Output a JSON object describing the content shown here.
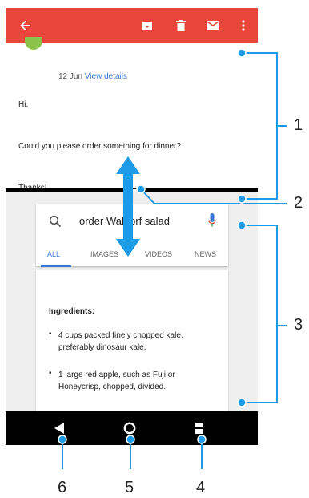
{
  "toolbar": {
    "back_icon": "arrow-back-icon",
    "archive_icon": "archive-icon",
    "delete_icon": "trash-icon",
    "mail_icon": "mail-icon",
    "more_icon": "more-vert-icon"
  },
  "email": {
    "date": "12 Jun",
    "view_details": "View details",
    "greeting": "Hi,",
    "body": "Could you please order something for dinner?",
    "signoff": "Thanks!"
  },
  "search": {
    "query": "order Waldorf salad",
    "tabs": [
      "ALL",
      "IMAGES",
      "VIDEOS",
      "NEWS"
    ],
    "active_tab": "ALL"
  },
  "ingredients": {
    "heading": "Ingredients:",
    "items": [
      "4 cups packed finely chopped kale, preferably dinosaur kale.",
      "1 large red apple, such as Fuji or Honeycrisp, chopped, divided."
    ]
  },
  "navbar": {
    "back": "nav-back-icon",
    "home": "nav-home-icon",
    "recents": "nav-recents-icon"
  },
  "callouts": [
    "1",
    "2",
    "3",
    "4",
    "5",
    "6"
  ],
  "colors": {
    "toolbar": "#e8463b",
    "callout": "#1e9be6",
    "accent": "#3b78d6",
    "arrow": "#1e9be6"
  }
}
